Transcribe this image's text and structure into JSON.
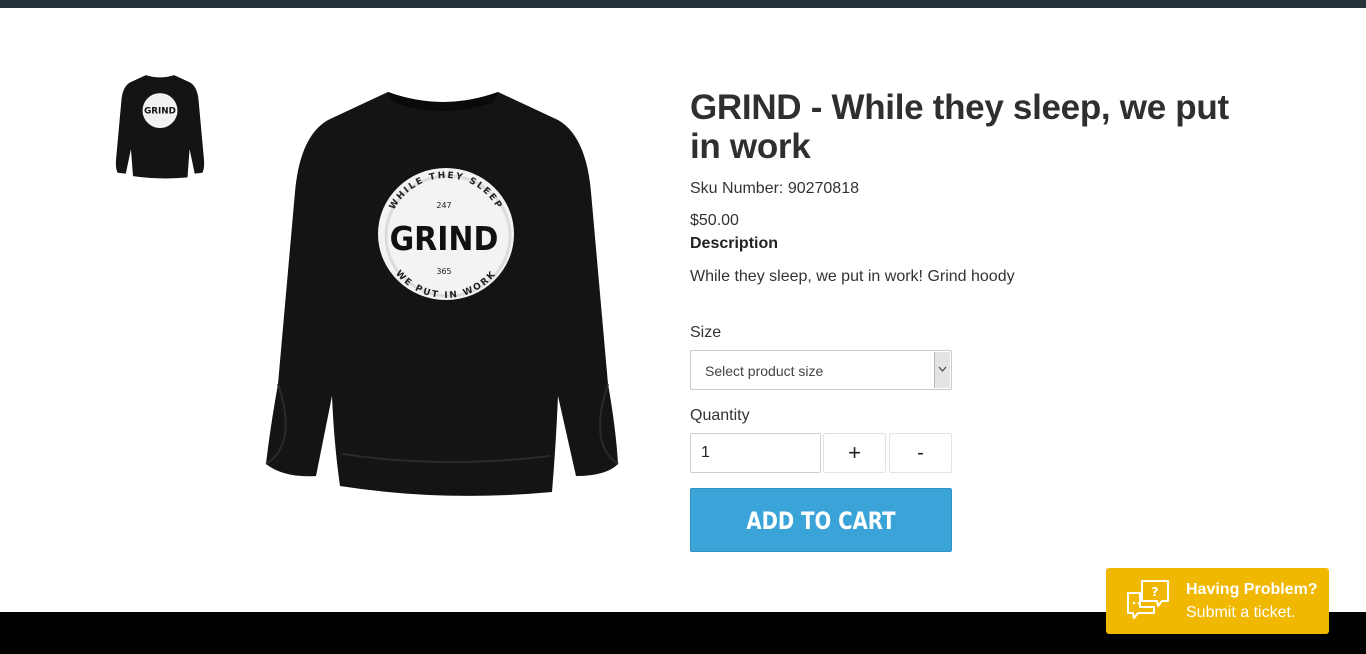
{
  "colors": {
    "top_bar": "#27323a",
    "footer": "#000000",
    "add_to_cart": "#3aa4d8",
    "help_widget": "#f0b800"
  },
  "gallery": {
    "thumbnail_icon": "sweatshirt-thumbnail",
    "main_image_icon": "sweatshirt-image",
    "print": {
      "top_text": "WHILE THEY SLEEP",
      "bottom_text": "WE PUT IN WORK",
      "center_text": "GRIND",
      "number_top": "247",
      "number_bottom": "365"
    }
  },
  "product": {
    "title": "GRIND - While they sleep, we put in work",
    "sku": "Sku Number: 90270818",
    "price": "$50.00",
    "description_heading": "Description",
    "description": "While they sleep, we put in work! Grind hoody"
  },
  "form": {
    "size_label": "Size",
    "size_selected": "Select product size",
    "quantity_label": "Quantity",
    "quantity_value": "1",
    "plus_label": "+",
    "minus_label": "-",
    "add_to_cart": "ADD TO CART"
  },
  "help": {
    "title": "Having Problem?",
    "subtitle": "Submit a ticket.",
    "icon": "chat-question-icon"
  }
}
